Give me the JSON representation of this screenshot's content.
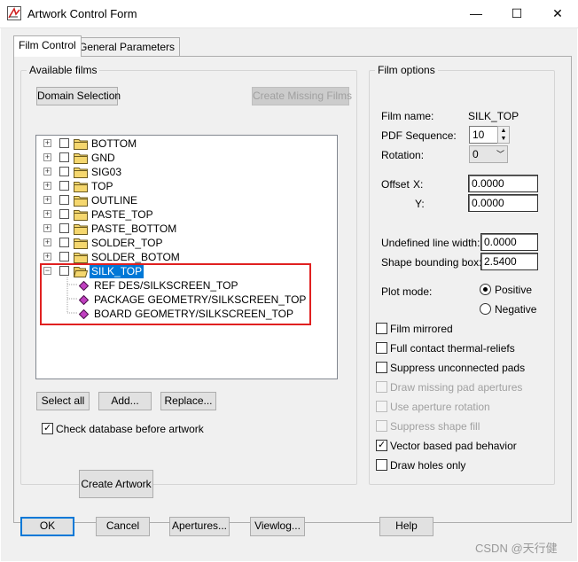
{
  "window": {
    "title": "Artwork Control Form",
    "minimize": "—",
    "maximize": "☐",
    "close": "✕"
  },
  "tabs": [
    {
      "label": "Film Control",
      "active": true
    },
    {
      "label": "General Parameters",
      "active": false
    }
  ],
  "available_films": {
    "legend": "Available films",
    "domain_button": "Domain Selection",
    "create_missing_button": "Create Missing Films",
    "films": [
      {
        "label": "BOTTOM",
        "expanded": false
      },
      {
        "label": "GND",
        "expanded": false
      },
      {
        "label": "SIG03",
        "expanded": false
      },
      {
        "label": "TOP",
        "expanded": false
      },
      {
        "label": "OUTLINE",
        "expanded": false
      },
      {
        "label": "PASTE_TOP",
        "expanded": false
      },
      {
        "label": "PASTE_BOTTOM",
        "expanded": false
      },
      {
        "label": "SOLDER_TOP",
        "expanded": false
      },
      {
        "label": "SOLDER_BOTOM",
        "expanded": false
      },
      {
        "label": "SILK_TOP",
        "expanded": true,
        "selected": true,
        "children": [
          {
            "label": "REF DES/SILKSCREEN_TOP"
          },
          {
            "label": "PACKAGE GEOMETRY/SILKSCREEN_TOP"
          },
          {
            "label": "BOARD GEOMETRY/SILKSCREEN_TOP"
          }
        ]
      }
    ],
    "select_all_button": "Select all",
    "add_button": "Add...",
    "replace_button": "Replace...",
    "check_database_label": "Check database before artwork",
    "check_database_checked": true,
    "create_artwork_button": "Create Artwork"
  },
  "film_options": {
    "legend": "Film options",
    "film_name_label": "Film name:",
    "film_name_value": "SILK_TOP",
    "pdf_sequence_label": "PDF Sequence:",
    "pdf_sequence_value": "10",
    "rotation_label": "Rotation:",
    "rotation_value": "0",
    "offset_label": "Offset",
    "offset_x_label": "X:",
    "offset_x_value": "0.0000",
    "offset_y_label": "Y:",
    "offset_y_value": "0.0000",
    "undefined_line_width_label": "Undefined line width:",
    "undefined_line_width_value": "0.0000",
    "shape_bounding_box_label": "Shape bounding box:",
    "shape_bounding_box_value": "2.5400",
    "plot_mode_label": "Plot mode:",
    "plot_mode_options": [
      {
        "label": "Positive",
        "selected": true
      },
      {
        "label": "Negative",
        "selected": false
      }
    ],
    "checkboxes": [
      {
        "label": "Film mirrored",
        "checked": false,
        "enabled": true
      },
      {
        "label": "Full contact thermal-reliefs",
        "checked": false,
        "enabled": true
      },
      {
        "label": "Suppress unconnected pads",
        "checked": false,
        "enabled": true
      },
      {
        "label": "Draw missing pad apertures",
        "checked": false,
        "enabled": false
      },
      {
        "label": "Use aperture rotation",
        "checked": false,
        "enabled": false
      },
      {
        "label": "Suppress shape fill",
        "checked": false,
        "enabled": false
      },
      {
        "label": "Vector based pad behavior",
        "checked": true,
        "enabled": true
      },
      {
        "label": "Draw holes only",
        "checked": false,
        "enabled": true
      }
    ]
  },
  "footer": {
    "ok": "OK",
    "cancel": "Cancel",
    "apertures": "Apertures...",
    "viewlog": "Viewlog...",
    "help": "Help"
  },
  "watermark": "CSDN @天行健",
  "colors": {
    "selection": "#0078d7",
    "highlight_box": "#e02020",
    "folder": "#f5d76e"
  }
}
